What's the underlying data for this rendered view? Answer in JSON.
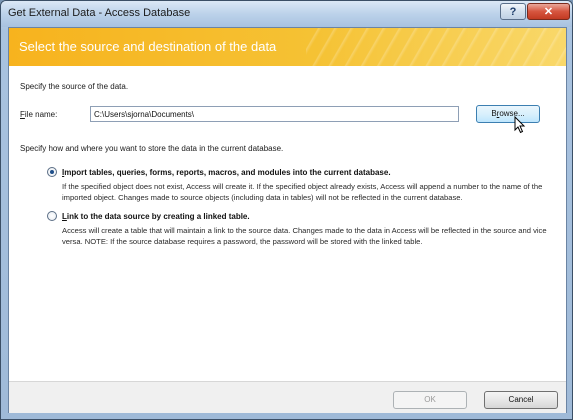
{
  "window": {
    "title": "Get External Data - Access Database",
    "help_label": "?",
    "close_label": "✕"
  },
  "banner": {
    "heading": "Select the source and destination of the data"
  },
  "source": {
    "instruction": "Specify the source of the data.",
    "file_name_label": "File name:",
    "file_name_value": "C:\\Users\\sjorna\\Documents\\",
    "browse_label": "Browse..."
  },
  "destination": {
    "instruction": "Specify how and where you want to store the data in the current database.",
    "options": [
      {
        "label": "Import tables, queries, forms, reports, macros, and modules into the current database.",
        "description": "If the specified object does not exist, Access will create it. If the specified object already exists, Access will append a number to the name of the imported object. Changes made to source objects (including data in tables) will not be reflected in the current database.",
        "selected": true
      },
      {
        "label": "Link to the data source by creating a linked table.",
        "description": "Access will create a table that will maintain a link to the source data. Changes made to the data in Access will be reflected in the source and vice versa. NOTE:  If the source database requires a password, the password will be stored with the linked table.",
        "selected": false
      }
    ]
  },
  "footer": {
    "ok_label": "OK",
    "cancel_label": "Cancel"
  },
  "colors": {
    "banner": "#f7b31e",
    "title_bar": "#bcd2ea",
    "close_button": "#c23a22"
  },
  "icons": [
    "help-icon",
    "close-icon",
    "mouse-pointer-icon"
  ]
}
